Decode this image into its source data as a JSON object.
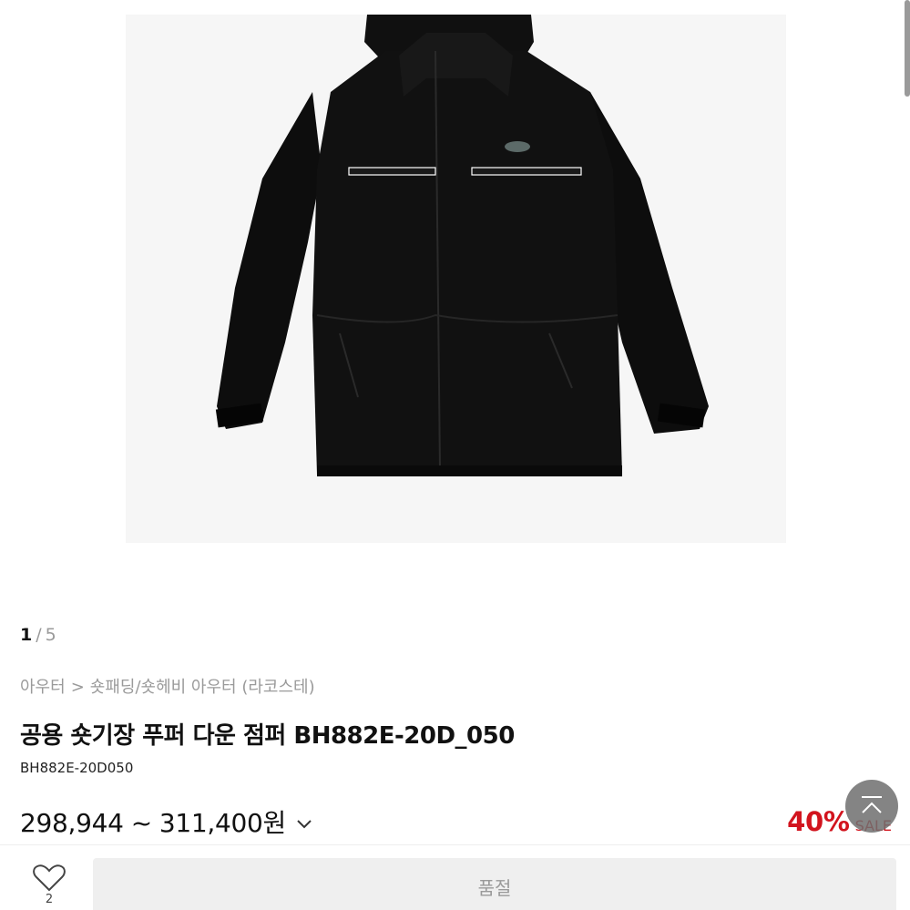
{
  "gallery": {
    "current": "1",
    "separator": "/",
    "total": "5",
    "image_alt": "black hooded puffer down jacket"
  },
  "breadcrumb": {
    "category": "아우터",
    "arrow": ">",
    "subcategory": "숏패딩/숏헤비 아우터 (라코스테)"
  },
  "product": {
    "name": "공용 숏기장 푸퍼 다운 점퍼 BH882E-20D_050",
    "code": "BH882E-20D050"
  },
  "price": {
    "min": "298,944",
    "tilde": "~",
    "max": "311,400",
    "unit": "원"
  },
  "discount": {
    "rate": "40%",
    "label": "SALE",
    "color": "#d2141e"
  },
  "bottom_bar": {
    "wish_icon": "heart-outline-icon",
    "wish_count": "2",
    "purchase_label": "품절"
  },
  "floating": {
    "scroll_top_icon": "arrow-up-to-top-icon"
  }
}
